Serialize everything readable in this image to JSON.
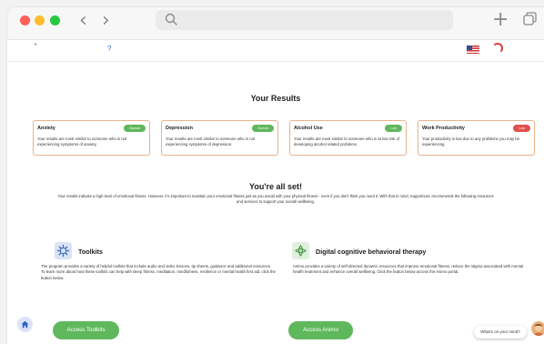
{
  "browser": {
    "back_icon": "chevron-left-icon",
    "forward_icon": "chevron-right-icon",
    "search_icon": "search-icon",
    "new_tab_icon": "plus-icon",
    "tabs_icon": "tabs-overview-icon"
  },
  "site_header": {
    "help_mark": "?",
    "flag_icon": "us-flag-icon"
  },
  "results": {
    "title": "Your Results",
    "cards": [
      {
        "title": "Anxiety",
        "badge": "Normal",
        "badge_color": "#5fb85c",
        "text": "Your results are most similar to someone who is not experiencing symptoms of anxiety."
      },
      {
        "title": "Depression",
        "badge": "Normal",
        "badge_color": "#5fb85c",
        "text": "Your results are most similar to someone who is not experiencing symptoms of depression."
      },
      {
        "title": "Alcohol Use",
        "badge": "Low",
        "badge_color": "#5fb85c",
        "text": "Your results are most similar to someone who is at low risk of developing alcohol related problems."
      },
      {
        "title": "Work Productivity",
        "badge": "Low",
        "badge_color": "#e0524f",
        "text": "Your productivity is low due to any problems you may be experiencing."
      }
    ]
  },
  "all_set": {
    "title": "You're all set!",
    "text": "Your results indicate a high level of emotional fitness. However, it's important to maintain your emotional fitness just as you would with your physical fitness - even if you don't think you need it. With that in mind, SupportLinc recommends the following resources and services to support your overall wellbeing."
  },
  "features": {
    "toolkits": {
      "icon": "gear-icon",
      "title": "Toolkits",
      "text": "The program provides a variety of helpful toolkits that include audio and video lessons, tip sheets, guidance and additional resources. To learn more about how these toolkits can help with sleep fitness, meditation, mindfulness, resilience or mental health first aid, click the button below.",
      "button": "Access Toolkits"
    },
    "animo": {
      "icon": "animo-logo-icon",
      "title": "Digital cognitive behavioral therapy",
      "text": "Animo provides a variety of self-directed dynamic resources that improve emotional fitness, reduce the stigma associated with mental health treatment and enhance overall wellbeing. Click the button below access the Animo portal.",
      "button": "Access Animo"
    }
  },
  "footer": {
    "home_icon": "home-icon",
    "chat_prompt": "What's on your mind?",
    "chat_avatar_icon": "chat-avatar-icon"
  },
  "colors": {
    "accent_green": "#5fb85c",
    "alert_red": "#e0524f",
    "card_border": "#e8b38a"
  }
}
